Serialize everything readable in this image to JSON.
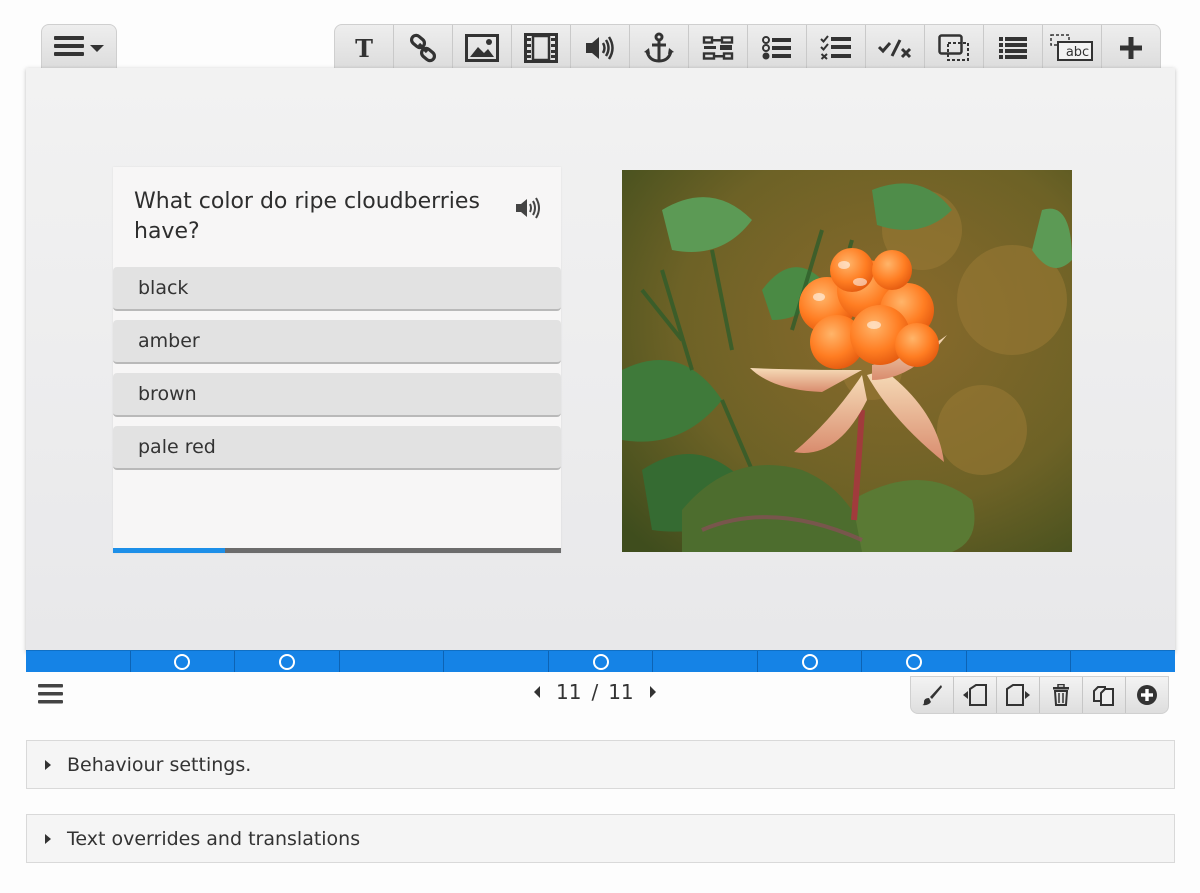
{
  "toolbar": {
    "menu_icon": "hamburger-dropdown-icon",
    "tools": [
      {
        "name": "text-tool",
        "icon": "text-icon"
      },
      {
        "name": "link-tool",
        "icon": "link-icon"
      },
      {
        "name": "image-tool",
        "icon": "image-icon"
      },
      {
        "name": "video-tool",
        "icon": "video-icon"
      },
      {
        "name": "audio-tool",
        "icon": "audio-icon"
      },
      {
        "name": "anchor-tool",
        "icon": "anchor-icon"
      },
      {
        "name": "drag-text-tool",
        "icon": "drag-text-icon"
      },
      {
        "name": "single-choice-tool",
        "icon": "single-choice-icon"
      },
      {
        "name": "multi-choice-tool",
        "icon": "multi-choice-icon"
      },
      {
        "name": "true-false-tool",
        "icon": "true-false-icon"
      },
      {
        "name": "drag-drop-tool",
        "icon": "drag-drop-icon"
      },
      {
        "name": "summary-tool",
        "icon": "summary-list-icon"
      },
      {
        "name": "fill-blanks-tool",
        "icon": "fill-blanks-icon"
      },
      {
        "name": "more-tool",
        "icon": "plus-icon"
      }
    ],
    "fill_blanks_label": "abc"
  },
  "slide": {
    "question": "What color do ripe cloudberries have?",
    "speaker_icon": "speaker-icon",
    "answers": [
      "black",
      "amber",
      "brown",
      "pale red"
    ],
    "progress": 0.25,
    "image_subject": "cloudberry"
  },
  "navigation": {
    "segments": 11,
    "dots": [
      1,
      2,
      5,
      7,
      8
    ],
    "accent": "#1583e6"
  },
  "pager": {
    "current": "11",
    "separator": "/",
    "total": "11"
  },
  "slide_actions": [
    {
      "name": "background-button",
      "icon": "brush-icon"
    },
    {
      "name": "move-left-button",
      "icon": "move-slide-left-icon"
    },
    {
      "name": "move-right-button",
      "icon": "move-slide-right-icon"
    },
    {
      "name": "delete-slide-button",
      "icon": "trash-icon"
    },
    {
      "name": "clone-slide-button",
      "icon": "clone-icon"
    },
    {
      "name": "add-slide-button",
      "icon": "add-circle-icon"
    }
  ],
  "panels": {
    "behaviour": "Behaviour settings.",
    "text_overrides": "Text overrides and translations"
  }
}
